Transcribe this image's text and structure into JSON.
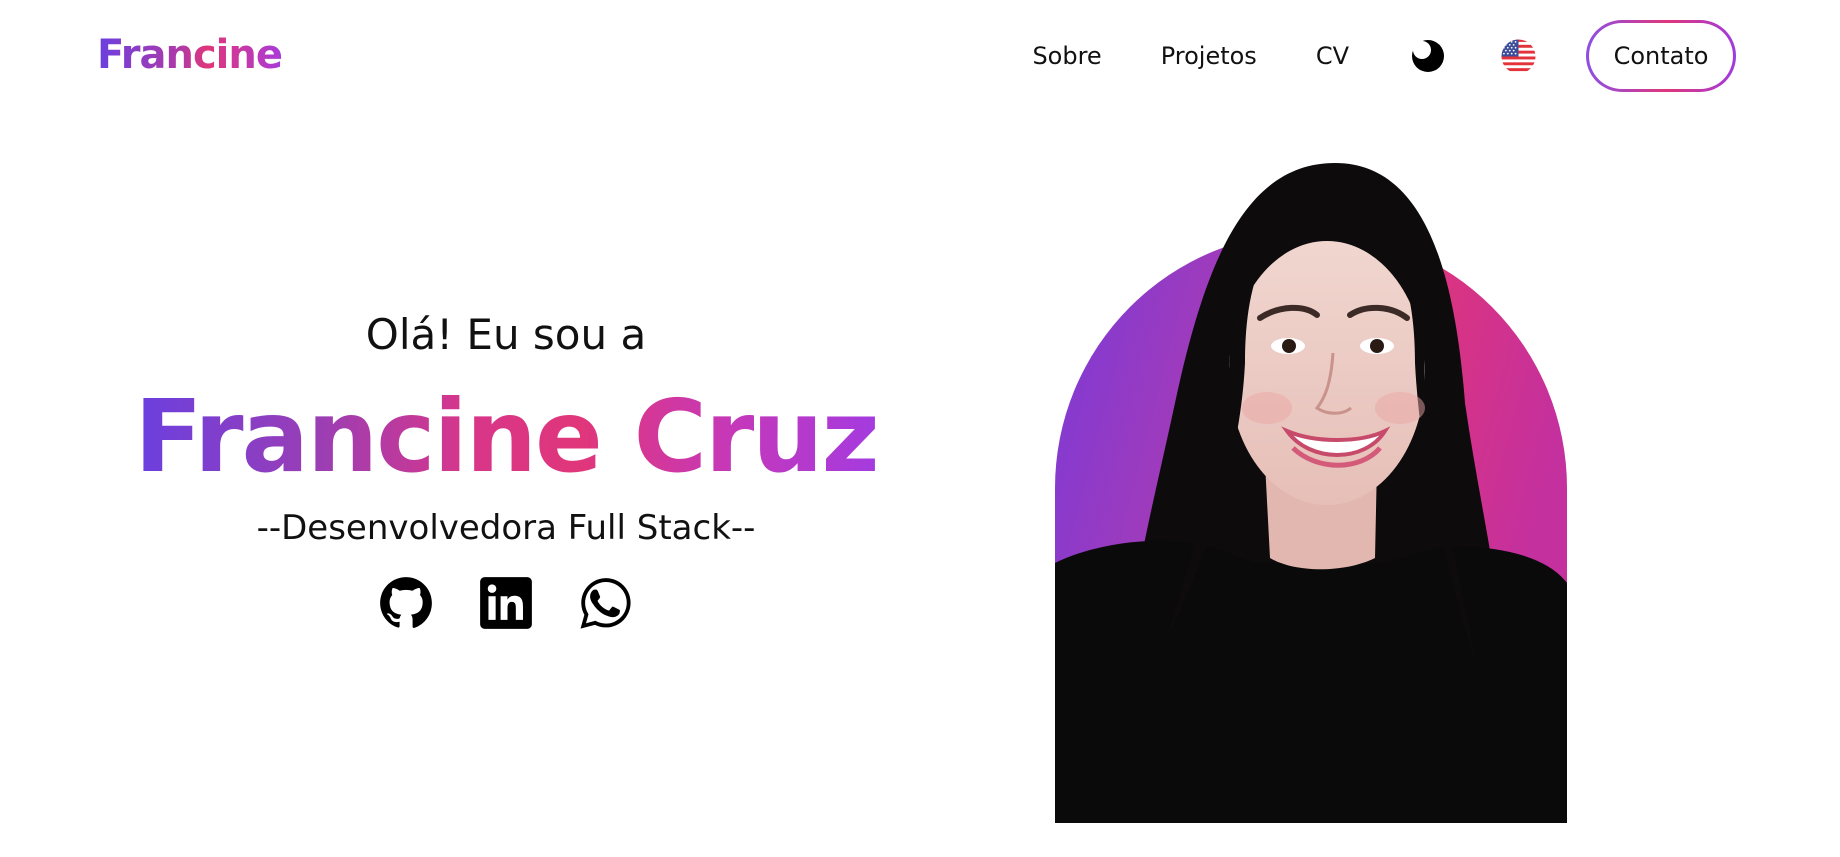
{
  "header": {
    "logo": "Francine",
    "nav": {
      "sobre": "Sobre",
      "projetos": "Projetos",
      "cv": "CV",
      "contact": "Contato"
    },
    "icons": {
      "theme_toggle": "moon-icon",
      "language": "us-flag-icon"
    }
  },
  "hero": {
    "greeting": "Olá! Eu sou a",
    "name": "Francine Cruz",
    "role": "--Desenvolvedora Full Stack--",
    "socials": [
      "github-icon",
      "linkedin-icon",
      "whatsapp-icon"
    ]
  },
  "colors": {
    "gradient_start": "#6a3fe0",
    "gradient_mid": "#e0367a",
    "gradient_end": "#a43be0",
    "text": "#111111",
    "background": "#ffffff"
  }
}
